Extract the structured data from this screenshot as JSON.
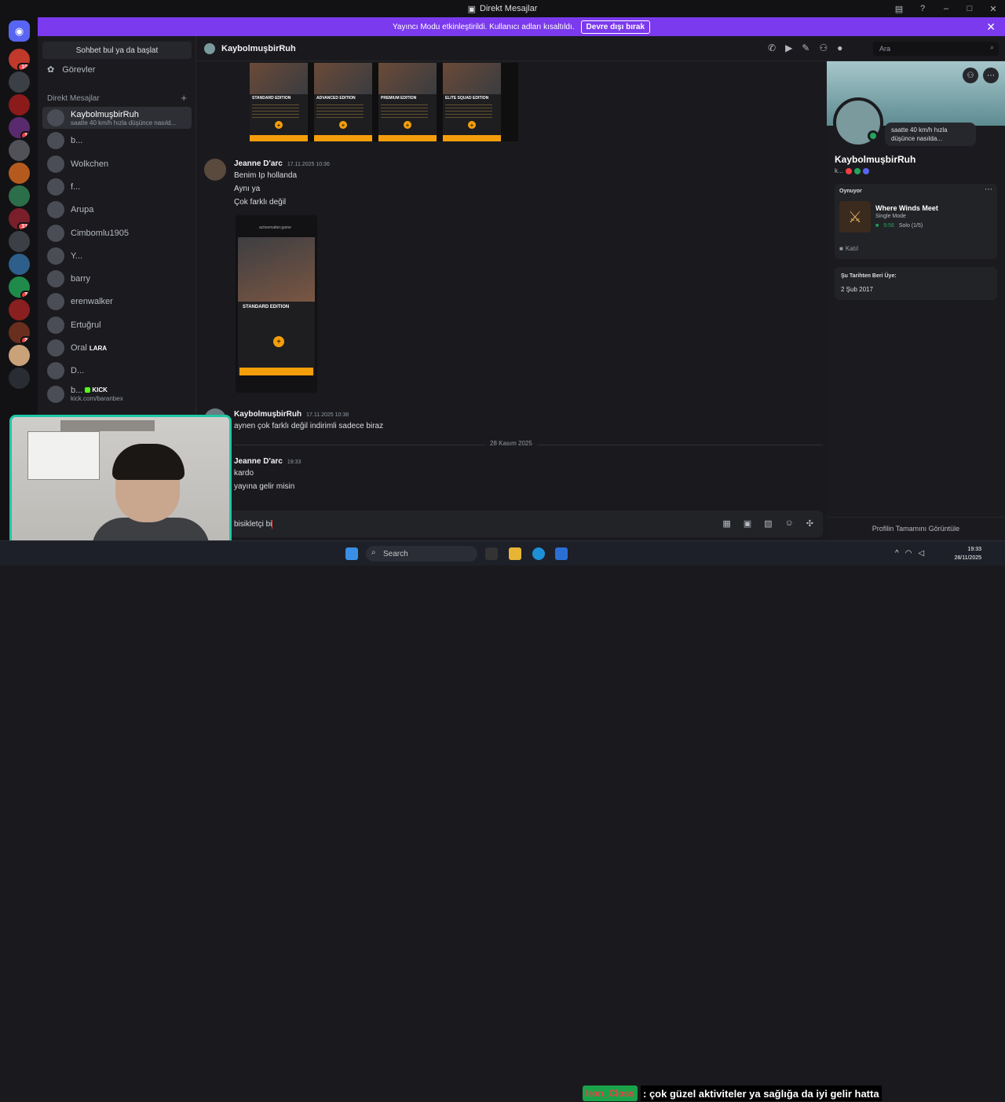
{
  "window": {
    "title": "Direkt Mesajlar"
  },
  "banner": {
    "text": "Yayıncı Modu etkinleştirildi. Kullanıcı adları kısaltıldı.",
    "button": "Devre dışı bırak"
  },
  "servers": [
    {
      "badge": "10"
    },
    {
      "badge": ""
    },
    {
      "badge": ""
    },
    {
      "badge": "1"
    },
    {
      "badge": ""
    },
    {
      "badge": ""
    },
    {
      "badge": ""
    },
    {
      "badge": "31"
    },
    {
      "badge": ""
    },
    {
      "badge": ""
    },
    {
      "badge": "7"
    },
    {
      "badge": ""
    },
    {
      "badge": "2"
    },
    {
      "badge": ""
    },
    {
      "badge": ""
    }
  ],
  "dm_sidebar": {
    "search": "Sohbet bul ya da başlat",
    "tasks": "Görevler",
    "header": "Direkt Mesajlar",
    "add": "+",
    "items": [
      {
        "name": "KaybolmuşbirRuh",
        "sub": "saatte 40 km/h hızla düşünce nasıld..."
      },
      {
        "name": "b...",
        "sub": ""
      },
      {
        "name": "Wolkchen",
        "sub": ""
      },
      {
        "name": "f...",
        "sub": ""
      },
      {
        "name": "Arupa",
        "sub": ""
      },
      {
        "name": "Cimbomlu1905",
        "sub": ""
      },
      {
        "name": "Y...",
        "sub": ""
      },
      {
        "name": "barry",
        "sub": ""
      },
      {
        "name": "erenwalker",
        "sub": ""
      },
      {
        "name": "Ertuğrul",
        "sub": ""
      },
      {
        "name": "Oral",
        "tag": "LARA"
      },
      {
        "name": "D...",
        "sub": ""
      },
      {
        "name": "b...",
        "tag": "KICK",
        "sub": "kick.com/baranbex"
      }
    ]
  },
  "chat": {
    "recipient": "KaybolmuşbirRuh",
    "search_placeholder": "Ara",
    "promo_editions": [
      "STANDARD EDITION",
      "ADVANCED EDITION",
      "PREMIUM EDITION",
      "ELITE SQUAD EDITION"
    ],
    "messages": [
      {
        "author": "Jeanne D'arc",
        "time": "17.11.2025 10:36",
        "lines": [
          "Benim Ip hollanda",
          "Aynı ya",
          "Çok farklı değil"
        ]
      },
      {
        "author": "KaybolmuşbirRuh",
        "time": "17.11.2025 10:38",
        "lines": [
          "aynen çok farklı değil indirimli sadece biraz"
        ]
      },
      {
        "author": "Jeanne D'arc",
        "time": "19:33",
        "lines": [
          "kardo",
          "yayına gelir misin"
        ]
      }
    ],
    "phone": {
      "url": "activematter.game",
      "title": "STANDARD EDITION"
    },
    "date_divider": "28 Kasım 2025",
    "composer_text": "bisikletçi bi"
  },
  "profile": {
    "name": "KaybolmuşbirRuh",
    "username": "k...",
    "status": "saatte 40 km/h hızla düşünce nasılda...",
    "activity_label": "Oynuyor",
    "game": "Where Winds Meet",
    "mode": "Single Mode",
    "elapsed": "9:56",
    "party": "Solo (1/5)",
    "join": "Katıl",
    "member_since_label": "Şu Tarihten Beri Üye:",
    "member_since": "2 Şub 2017",
    "full_profile": "Profilin Tamamını Görüntüle"
  },
  "taskbar": {
    "search": "Search",
    "caption_channel": "Iron_Closs",
    "caption_text": ": çok güzel aktiviteler ya sağlığa da iyi gelir hatta",
    "time": "19:33",
    "date": "28/11/2025"
  },
  "colors": {
    "banner": "#7b3aed",
    "accent": "#5865f2",
    "online": "#23a55a",
    "webcam_border": "#1fc7a6"
  }
}
